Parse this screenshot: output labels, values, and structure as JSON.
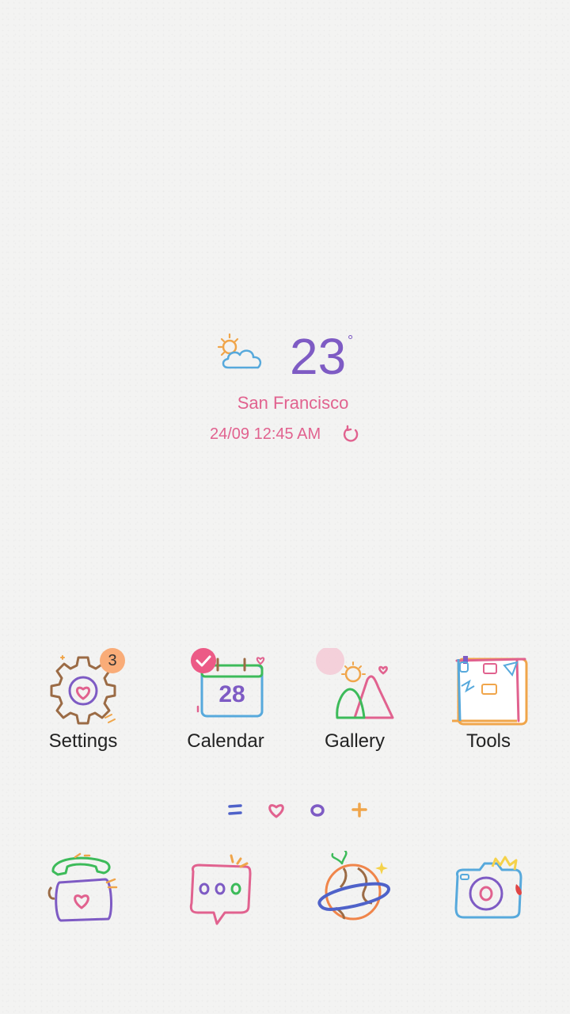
{
  "weather": {
    "temperature": "23",
    "degree_symbol": "°",
    "city": "San Francisco",
    "datetime": "24/09 12:45 AM",
    "icon": "partly-cloudy-icon"
  },
  "apps": [
    {
      "label": "Settings",
      "icon": "settings-gear-icon",
      "badge": "3"
    },
    {
      "label": "Calendar",
      "icon": "calendar-icon",
      "calendar_day": "28"
    },
    {
      "label": "Gallery",
      "icon": "gallery-icon"
    },
    {
      "label": "Tools",
      "icon": "tools-folder-icon"
    }
  ],
  "pager_icons": [
    "menu-page-icon",
    "heart-page-icon",
    "circle-page-icon",
    "plus-page-icon"
  ],
  "dock": [
    {
      "icon": "phone-icon"
    },
    {
      "icon": "messages-icon"
    },
    {
      "icon": "internet-planet-icon"
    },
    {
      "icon": "camera-icon"
    }
  ],
  "colors": {
    "purple": "#7e5bc4",
    "pink": "#e1628f",
    "badge": "#f9ac78"
  }
}
